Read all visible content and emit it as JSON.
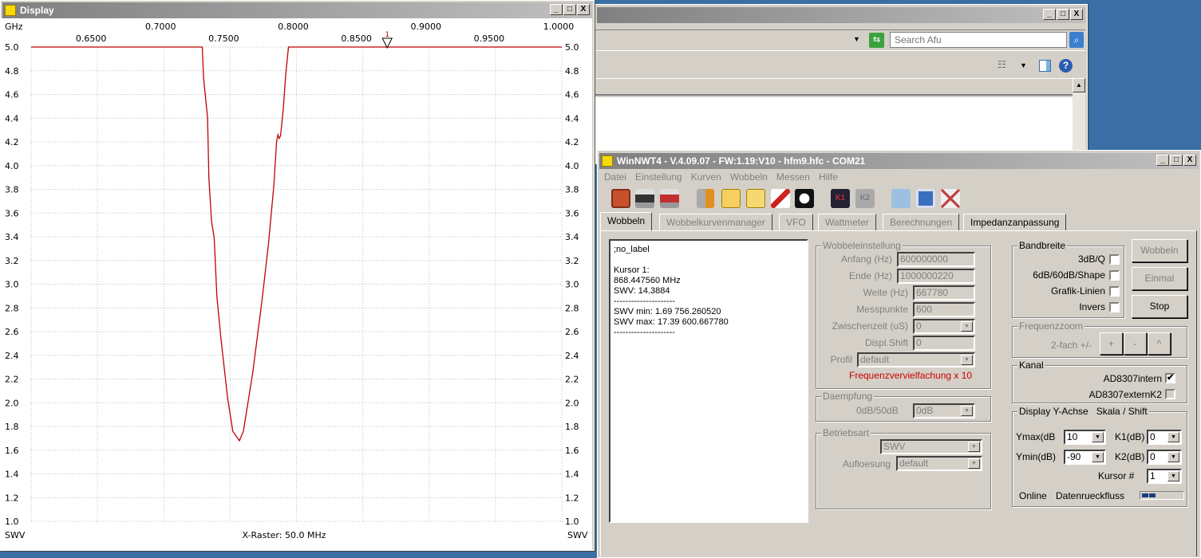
{
  "display_window": {
    "title": "Display",
    "x_unit": "GHz",
    "bottom_left": "SWV",
    "bottom_right": "SWV",
    "x_raster": "X-Raster: 50.0 MHz",
    "cursor_label": "1"
  },
  "chart_data": {
    "type": "line",
    "xlabel": "GHz",
    "ylabel": "SWV",
    "xlim": [
      0.6,
      1.0
    ],
    "ylim": [
      1.0,
      5.0
    ],
    "grid": true,
    "x_ticks_upper": [
      "0.7000",
      "0.8000",
      "0.9000",
      "1.0000"
    ],
    "x_ticks_lower": [
      "0.6500",
      "0.7500",
      "0.8500",
      "0.9500"
    ],
    "y_ticks": [
      "5.0",
      "4.8",
      "4.6",
      "4.4",
      "4.2",
      "4.0",
      "3.8",
      "3.6",
      "3.4",
      "3.2",
      "3.0",
      "2.8",
      "2.6",
      "2.4",
      "2.2",
      "2.0",
      "1.8",
      "1.6",
      "1.4",
      "1.2",
      "1.0"
    ],
    "line_color": "#c00000",
    "cursor": {
      "x": 0.8684,
      "label": "1"
    },
    "series": [
      {
        "x": [
          0.6,
          0.729,
          0.73,
          0.733,
          0.734,
          0.736,
          0.738,
          0.74,
          0.743,
          0.748,
          0.752,
          0.757,
          0.76,
          0.767,
          0.774,
          0.779,
          0.783,
          0.785,
          0.786,
          0.787,
          0.788,
          0.79,
          0.792,
          0.794,
          1.0
        ],
        "y": [
          5.0,
          5.0,
          4.74,
          4.4,
          3.89,
          3.53,
          3.39,
          2.9,
          2.55,
          2.05,
          1.76,
          1.68,
          1.76,
          2.25,
          2.86,
          3.35,
          3.84,
          4.2,
          4.26,
          4.23,
          4.25,
          4.47,
          4.78,
          5.0,
          5.0
        ]
      }
    ]
  },
  "explorer": {
    "search_placeholder": "Search Afu"
  },
  "winnwt": {
    "title": "WinNWT4 - V.4.09.07 - FW:1.19:V10 - hfm9.hfc - COM21",
    "menu": [
      "Datei",
      "Einstellung",
      "Kurven",
      "Wobbeln",
      "Messen",
      "Hilfe"
    ],
    "tabs": [
      "Wobbeln",
      "Wobbelkurvenmanager",
      "VFO",
      "Wattmeter",
      "Berechnungen",
      "Impedanzanpassung"
    ],
    "info_lines": [
      ";no_label",
      "",
      "Kursor 1:",
      "868.447560 MHz",
      "SWV: 14.3884",
      "---------------------",
      "SWV min: 1.69  756.260520",
      "SWV max: 17.39  600.667780",
      "---------------------"
    ],
    "wobbeleinstellung": {
      "title": "Wobbeleinstellung",
      "anfang_label": "Anfang (Hz)",
      "anfang": "600000000",
      "ende_label": "Ende (Hz)",
      "ende": "1000000220",
      "weite_label": "Weite (Hz)",
      "weite": "667780",
      "messpunkte_label": "Messpunkte",
      "messpunkte": "600",
      "zwischenzeit_label": "Zwischenzeit (uS)",
      "zwischenzeit": "0",
      "displshift_label": "Displ.Shift",
      "displshift": "0",
      "profil_label": "Profil",
      "profil": "default",
      "note": "Frequenzvervielfachung x 10",
      "note_color": "#cc0000"
    },
    "daempfung": {
      "title": "Daempfung",
      "label": "0dB/50dB",
      "value": "0dB"
    },
    "betriebsart": {
      "title": "Betriebsart",
      "mode": "SWV",
      "aufloesung_label": "Aufloesung",
      "aufloesung": "default"
    },
    "bandbreite": {
      "title": "Bandbreite",
      "items": [
        {
          "label": "3dB/Q",
          "checked": false
        },
        {
          "label": "6dB/60dB/Shape",
          "checked": false
        },
        {
          "label": "Grafik-Linien",
          "checked": false
        },
        {
          "label": "Invers",
          "checked": false
        }
      ]
    },
    "buttons": {
      "wobbeln": "Wobbeln",
      "einmal": "Einmal",
      "stop": "Stop"
    },
    "frequenzzoom": {
      "title": "Frequenzzoom",
      "label": "2-fach +/-",
      "plus": "+",
      "minus": "-",
      "caret": "^"
    },
    "kanal": {
      "title": "Kanal",
      "intern": "AD8307intern",
      "intern_checked": true,
      "extern": "AD8307externK2",
      "extern_checked": false,
      "check": "✔"
    },
    "yachse": {
      "title": "Display Y-Achse   Skala / Shift",
      "ymax_label": "Ymax(dB",
      "ymax": "10",
      "ymin_label": "Ymin(dB)",
      "ymin": "-90",
      "k1_label": "K1(dB)",
      "k1": "0",
      "k2_label": "K2(dB)",
      "k2": "0",
      "kursor_label": "Kursor #",
      "kursor": "1",
      "online": "Online",
      "datenrueckfluss": "Datenrueckfluss"
    }
  }
}
